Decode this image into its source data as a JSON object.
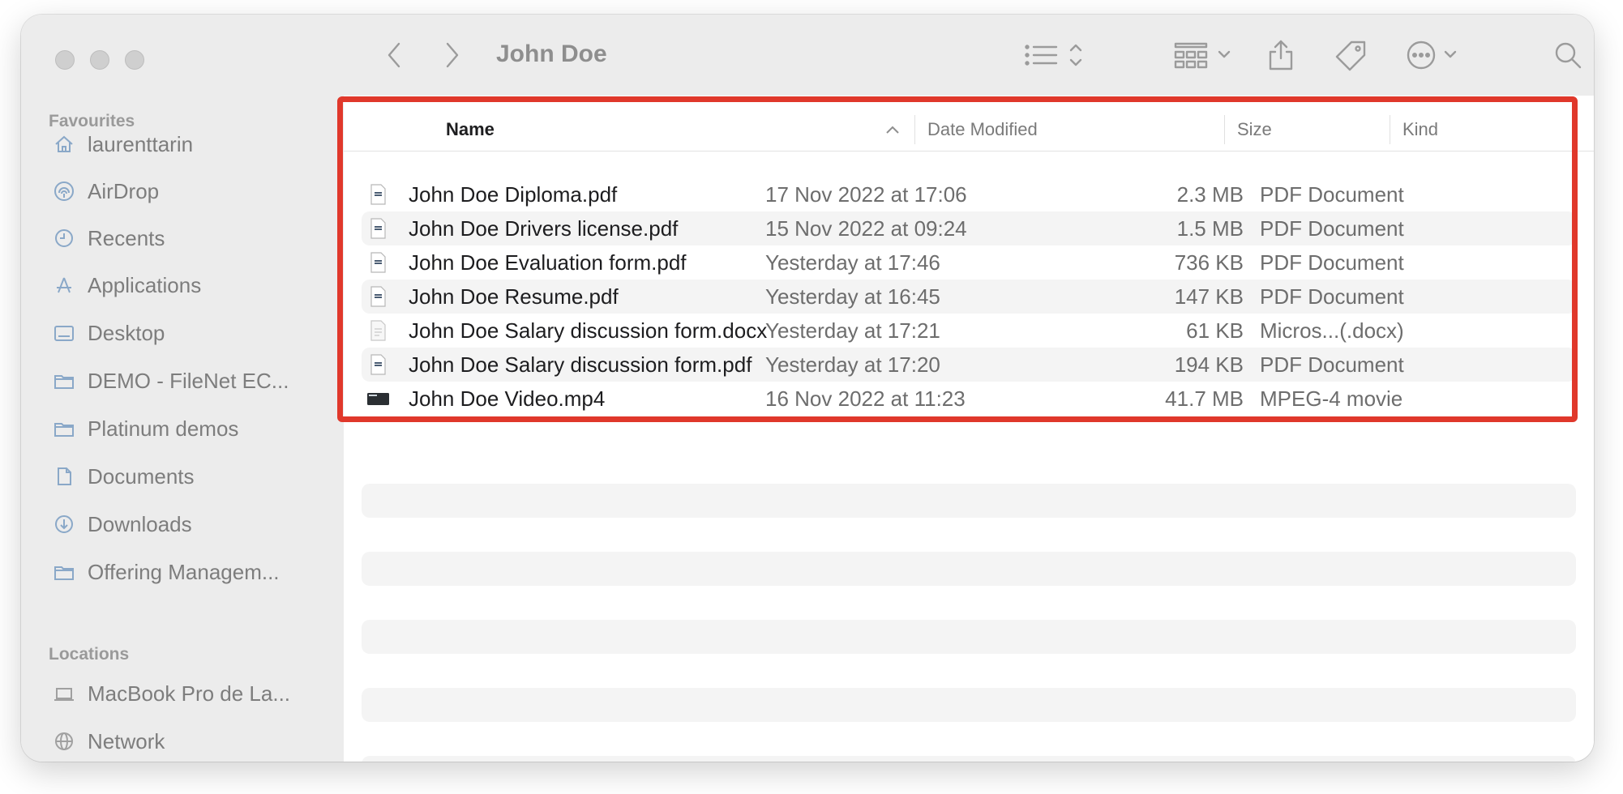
{
  "window": {
    "title": "John Doe"
  },
  "sidebar": {
    "favourites_title": "Favourites",
    "favourites": [
      {
        "label": "laurenttarin",
        "icon": "home-icon"
      },
      {
        "label": "AirDrop",
        "icon": "airdrop-icon"
      },
      {
        "label": "Recents",
        "icon": "clock-icon"
      },
      {
        "label": "Applications",
        "icon": "applications-icon"
      },
      {
        "label": "Desktop",
        "icon": "desktop-icon"
      },
      {
        "label": "DEMO - FileNet EC...",
        "icon": "folder-icon"
      },
      {
        "label": "Platinum demos",
        "icon": "folder-icon"
      },
      {
        "label": "Documents",
        "icon": "document-icon"
      },
      {
        "label": "Downloads",
        "icon": "download-icon"
      },
      {
        "label": "Offering Managem...",
        "icon": "folder-icon"
      }
    ],
    "locations_title": "Locations",
    "locations": [
      {
        "label": "MacBook Pro de La...",
        "icon": "laptop-icon"
      },
      {
        "label": "Network",
        "icon": "network-icon"
      }
    ]
  },
  "toolbar": {
    "buttons": [
      "back-icon",
      "forward-icon",
      "list-view-icon",
      "grid-view-icon",
      "share-icon",
      "tag-icon",
      "more-icon",
      "search-icon"
    ]
  },
  "columns": {
    "name": "Name",
    "date": "Date Modified",
    "size": "Size",
    "kind": "Kind"
  },
  "files": [
    {
      "name": "John Doe Diploma.pdf",
      "date": "17 Nov 2022 at 17:06",
      "size": "2.3 MB",
      "kind": "PDF Document",
      "icon": "pdf-icon"
    },
    {
      "name": "John Doe Drivers license.pdf",
      "date": "15 Nov 2022 at 09:24",
      "size": "1.5 MB",
      "kind": "PDF Document",
      "icon": "pdf-icon"
    },
    {
      "name": "John Doe Evaluation form.pdf",
      "date": "Yesterday at 17:46",
      "size": "736 KB",
      "kind": "PDF Document",
      "icon": "pdf-icon"
    },
    {
      "name": "John Doe Resume.pdf",
      "date": "Yesterday at 16:45",
      "size": "147 KB",
      "kind": "PDF Document",
      "icon": "pdf-icon"
    },
    {
      "name": "John Doe Salary discussion form.docx",
      "date": "Yesterday at 17:21",
      "size": "61 KB",
      "kind": "Micros...(.docx)",
      "icon": "docx-icon"
    },
    {
      "name": "John Doe Salary discussion form.pdf",
      "date": "Yesterday at 17:20",
      "size": "194 KB",
      "kind": "PDF Document",
      "icon": "pdf-icon"
    },
    {
      "name": "John Doe Video.mp4",
      "date": "16 Nov 2022 at 11:23",
      "size": "41.7 MB",
      "kind": "MPEG-4 movie",
      "icon": "video-icon"
    }
  ],
  "colors": {
    "highlight": "#e0382b",
    "sidebar_bg": "#ececec",
    "icon_accent": "#8aa8c8"
  }
}
